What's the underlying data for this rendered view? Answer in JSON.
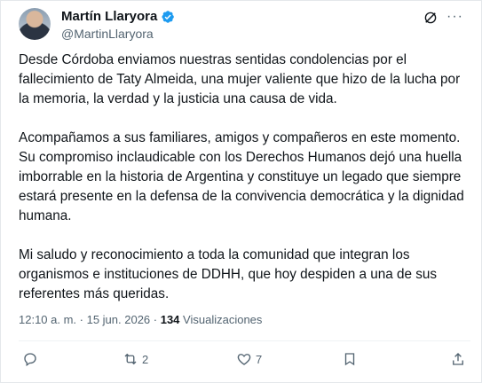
{
  "author": {
    "name": "Martín Llaryora",
    "handle": "@MartinLlaryora"
  },
  "post": {
    "paragraphs": [
      "Desde Córdoba enviamos nuestras sentidas condolencias por el fallecimiento de Taty Almeida, una mujer valiente que hizo de la lucha por la memoria, la verdad y la justicia una causa de vida.",
      "Acompañamos a sus familiares, amigos y compañeros en este momento. Su compromiso inclaudicable con los Derechos Humanos dejó una huella imborrable en la historia de Argentina y constituye un legado que siempre estará presente en la defensa de la convivencia democrática y la dignidad humana.",
      "Mi saludo y reconocimiento a toda la comunidad que integran los organismos e instituciones de DDHH, que hoy despiden a una de sus referentes más queridas."
    ],
    "time": "12:10 a. m. · 15 jun. 2026 · ",
    "views_count": "134",
    "views_label": " Visualizaciones"
  },
  "actions": {
    "reply_count": "",
    "repost_count": "2",
    "like_count": "7"
  },
  "icons": {
    "verified": "verified-badge-icon",
    "grok": "grok-icon",
    "more": "more-icon",
    "reply": "reply-icon",
    "repost": "repost-icon",
    "like": "heart-icon",
    "bookmark": "bookmark-icon",
    "share": "share-icon"
  },
  "colors": {
    "verified": "#1d9bf0",
    "text": "#0f1419",
    "secondary": "#536471"
  }
}
